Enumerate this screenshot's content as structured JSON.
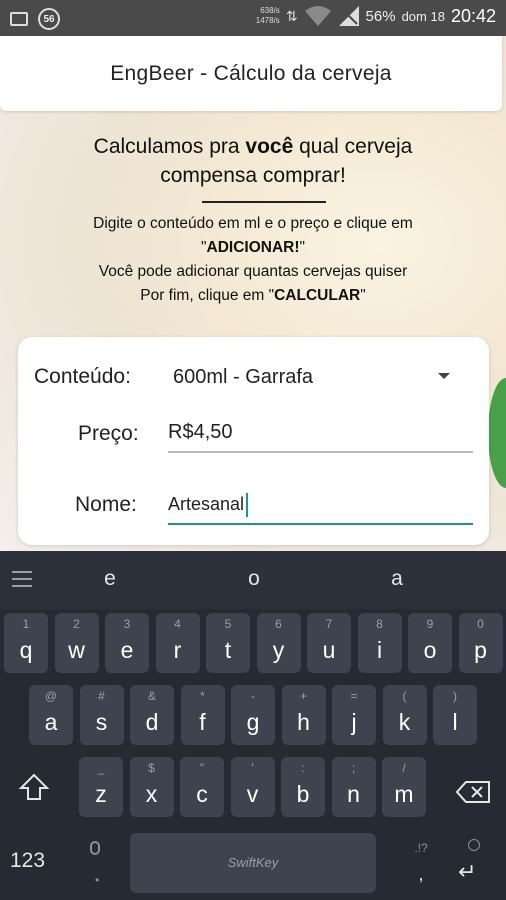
{
  "status_bar": {
    "notification_badge": "56",
    "rate_up": "638/s",
    "rate_down": "1478/s",
    "battery": "56%",
    "day": "dom 18",
    "time": "20:42",
    "icons": [
      "image-icon",
      "data-arrows-icon",
      "wifi-icon",
      "signal-icon"
    ]
  },
  "app_bar": {
    "title": "EngBeer - Cálculo da cerveja"
  },
  "headline": {
    "line1_pre": "Calculamos pra ",
    "line1_bold": "você",
    "line1_post": " qual cerveja",
    "line2": "compensa comprar!"
  },
  "instructions": {
    "line1": "Digite o conteúdo em ml e o preço e clique em",
    "line2_q1": "\"",
    "line2_bold": "ADICIONAR!",
    "line2_q2": "\"",
    "line3": "Você pode adicionar quantas cervejas quiser",
    "line4_pre": "Por fim, clique em \"",
    "line4_bold": "CALCULAR",
    "line4_post": "\""
  },
  "form": {
    "content_label": "Conteúdo:",
    "content_value": "600ml - Garrafa",
    "price_label": "Preço:",
    "price_value": "R$4,50",
    "name_label": "Nome:",
    "name_value": "Artesanal"
  },
  "keyboard": {
    "suggestions": [
      "e",
      "o",
      "a"
    ],
    "row1": [
      {
        "main": "q",
        "sub": "1"
      },
      {
        "main": "w",
        "sub": "2"
      },
      {
        "main": "e",
        "sub": "3"
      },
      {
        "main": "r",
        "sub": "4"
      },
      {
        "main": "t",
        "sub": "5"
      },
      {
        "main": "y",
        "sub": "6"
      },
      {
        "main": "u",
        "sub": "7"
      },
      {
        "main": "i",
        "sub": "8"
      },
      {
        "main": "o",
        "sub": "9"
      },
      {
        "main": "p",
        "sub": "0"
      }
    ],
    "row2": [
      {
        "main": "a",
        "sub": "@"
      },
      {
        "main": "s",
        "sub": "#"
      },
      {
        "main": "d",
        "sub": "&"
      },
      {
        "main": "f",
        "sub": "*"
      },
      {
        "main": "g",
        "sub": "-"
      },
      {
        "main": "h",
        "sub": "+"
      },
      {
        "main": "j",
        "sub": "="
      },
      {
        "main": "k",
        "sub": "("
      },
      {
        "main": "l",
        "sub": ")"
      }
    ],
    "row3": [
      {
        "main": "z",
        "sub": "_"
      },
      {
        "main": "x",
        "sub": "$"
      },
      {
        "main": "c",
        "sub": "\""
      },
      {
        "main": "v",
        "sub": "'"
      },
      {
        "main": "b",
        "sub": ":"
      },
      {
        "main": "n",
        "sub": ";"
      },
      {
        "main": "m",
        "sub": "/"
      }
    ],
    "numbers_key": "123",
    "space_label": "SwiftKey",
    "punct_top": ".!?",
    "punct_bottom": ","
  }
}
